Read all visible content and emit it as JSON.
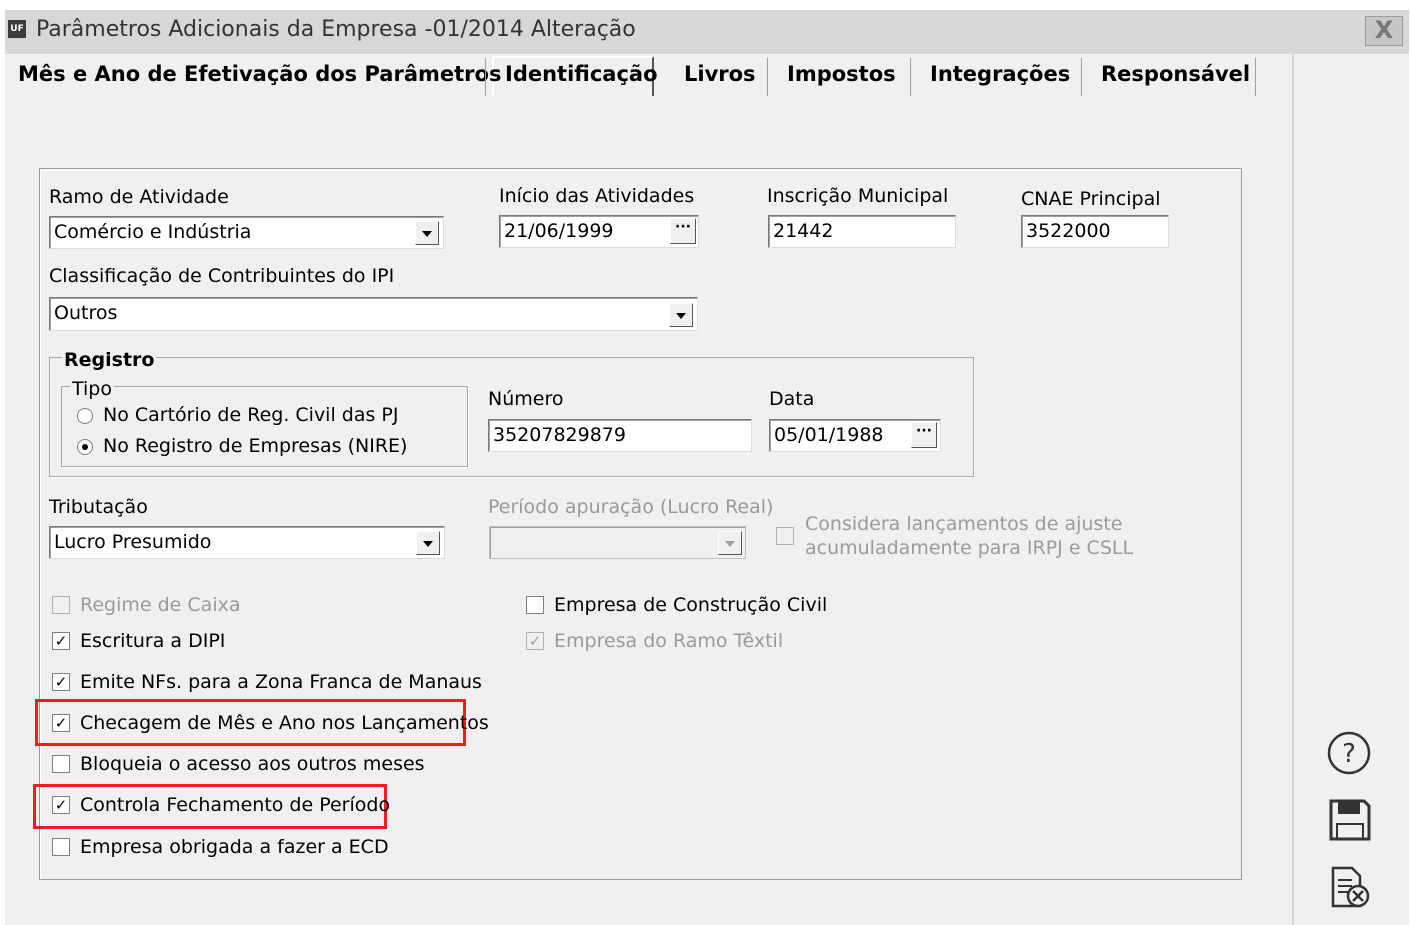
{
  "window": {
    "title": "Parâmetros Adicionais da Empresa -01/2014 Alteração",
    "app_icon": "UF",
    "close_glyph": "X"
  },
  "tabs": [
    {
      "label": "Mês e Ano de Efetivação dos Parâmetros"
    },
    {
      "label": "Identificação",
      "active": true
    },
    {
      "label": "Livros"
    },
    {
      "label": "Impostos"
    },
    {
      "label": "Integrações"
    },
    {
      "label": "Responsável"
    }
  ],
  "form": {
    "ramo": {
      "label": "Ramo de Atividade",
      "value": "Comércio e Indústria"
    },
    "inicio": {
      "label": "Início das Atividades",
      "value": "21/06/1999"
    },
    "inscricao": {
      "label": "Inscrição Municipal",
      "value": "21442"
    },
    "cnae": {
      "label": "CNAE Principal",
      "value": "3522000"
    },
    "classificacao": {
      "label": "Classificação de Contribuintes do IPI",
      "value": "Outros"
    },
    "registro": {
      "label": "Registro",
      "tipo_label": "Tipo",
      "options": [
        {
          "label": "No Cartório de Reg. Civil das PJ",
          "selected": false
        },
        {
          "label": "No Registro de Empresas (NIRE)",
          "selected": true
        }
      ],
      "numero": {
        "label": "Número",
        "value": "35207829879"
      },
      "data": {
        "label": "Data",
        "value": "05/01/1988"
      }
    },
    "tributacao": {
      "label": "Tributação",
      "value": "Lucro Presumido"
    },
    "periodo": {
      "label": "Período apuração (Lucro Real)",
      "value": ""
    },
    "considera": {
      "line1": "Considera lançamentos de ajuste",
      "line2": "acumuladamente para IRPJ e CSLL",
      "checked": false
    },
    "checks_left": [
      {
        "label": "Regime de Caixa",
        "checked": false,
        "disabled": true
      },
      {
        "label": "Escritura a DIPI",
        "checked": true,
        "disabled": false
      },
      {
        "label": "Emite NFs. para a Zona Franca de Manaus",
        "checked": true,
        "disabled": false
      },
      {
        "label": "Checagem de Mês e Ano nos Lançamentos",
        "checked": true,
        "disabled": false,
        "highlight": true
      },
      {
        "label": "Bloqueia o acesso aos outros meses",
        "checked": false,
        "disabled": false
      },
      {
        "label": "Controla Fechamento de Período",
        "checked": true,
        "disabled": false,
        "highlight": true
      },
      {
        "label": "Empresa obrigada a fazer a ECD",
        "checked": false,
        "disabled": false
      }
    ],
    "checks_right": [
      {
        "label": "Empresa de Construção Civil",
        "checked": false,
        "disabled": false
      },
      {
        "label": "Empresa do Ramo Têxtil",
        "checked": true,
        "disabled": true
      }
    ]
  },
  "sidebar_icons": [
    "help-icon",
    "save-icon",
    "cancel-document-icon"
  ],
  "colors": {
    "highlight": "#ee1c24",
    "titlebar": "#d7d7d7",
    "window_bg": "#f0f0f0"
  }
}
